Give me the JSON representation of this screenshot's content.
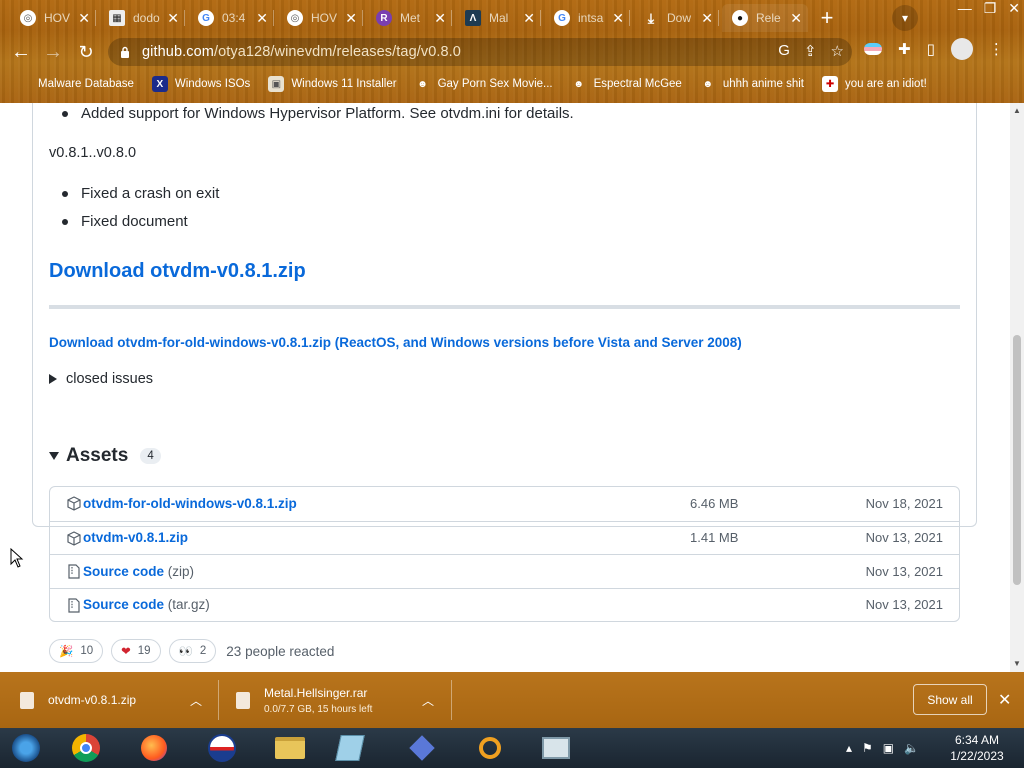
{
  "browser": {
    "tabs": [
      {
        "title": "HOV",
        "icon": "globe-icon"
      },
      {
        "title": "dodo",
        "icon": "app-icon"
      },
      {
        "title": "03:4",
        "icon": "google-icon"
      },
      {
        "title": "HOV",
        "icon": "globe-icon"
      },
      {
        "title": "Met",
        "icon": "app-icon"
      },
      {
        "title": "Mal",
        "icon": "app-icon"
      },
      {
        "title": "intsa",
        "icon": "google-icon"
      },
      {
        "title": "Dow",
        "icon": "download-icon"
      },
      {
        "title": "Rele",
        "icon": "github-icon"
      }
    ],
    "url_host": "github.com",
    "url_path": "/otya128/winevdm/releases/tag/v0.8.0",
    "bookmarks": [
      {
        "label": "Malware Database"
      },
      {
        "label": "Windows ISOs"
      },
      {
        "label": "Windows 11 Installer"
      },
      {
        "label": "Gay Porn Sex Movie..."
      },
      {
        "label": "Espectral McGee"
      },
      {
        "label": "uhhh anime shit"
      },
      {
        "label": "you are an idiot!"
      }
    ]
  },
  "release": {
    "top_bullet": "Added support for Windows Hypervisor Platform. See otvdm.ini for details.",
    "range_text": "v0.8.1..v0.8.0",
    "fixes": [
      "Fixed a crash on exit",
      "Fixed document"
    ],
    "download_heading": "Download otvdm-v0.8.1.zip",
    "download_old": "Download otvdm-for-old-windows-v0.8.1.zip (ReactOS, and Windows versions before Vista and Server 2008)",
    "closed_issues": "closed issues"
  },
  "assets": {
    "title": "Assets",
    "count": "4",
    "rows": [
      {
        "name": "otvdm-for-old-windows-v0.8.1.zip",
        "format": "",
        "size": "6.46 MB",
        "date": "Nov 18, 2021"
      },
      {
        "name": "otvdm-v0.8.1.zip",
        "format": "",
        "size": "1.41 MB",
        "date": "Nov 13, 2021"
      },
      {
        "name": "Source code",
        "format": "(zip)",
        "size": "",
        "date": "Nov 13, 2021"
      },
      {
        "name": "Source code",
        "format": "(tar.gz)",
        "size": "",
        "date": "Nov 13, 2021"
      }
    ]
  },
  "reactions": {
    "items": [
      {
        "emoji": "🎉",
        "count": "10"
      },
      {
        "emoji": "❤",
        "count": "19"
      },
      {
        "emoji": "👀",
        "count": "2"
      }
    ],
    "summary": "23 people reacted"
  },
  "downloads": {
    "items": [
      {
        "name": "otvdm-v0.8.1.zip",
        "status": ""
      },
      {
        "name": "Metal.Hellsinger.rar",
        "status": "0.0/7.7 GB, 15 hours left"
      }
    ],
    "show_all": "Show all"
  },
  "taskbar": {
    "time": "6:34 AM",
    "date": "1/22/2023"
  },
  "colors": {
    "link": "#0969da",
    "frame": "#b06a14"
  }
}
